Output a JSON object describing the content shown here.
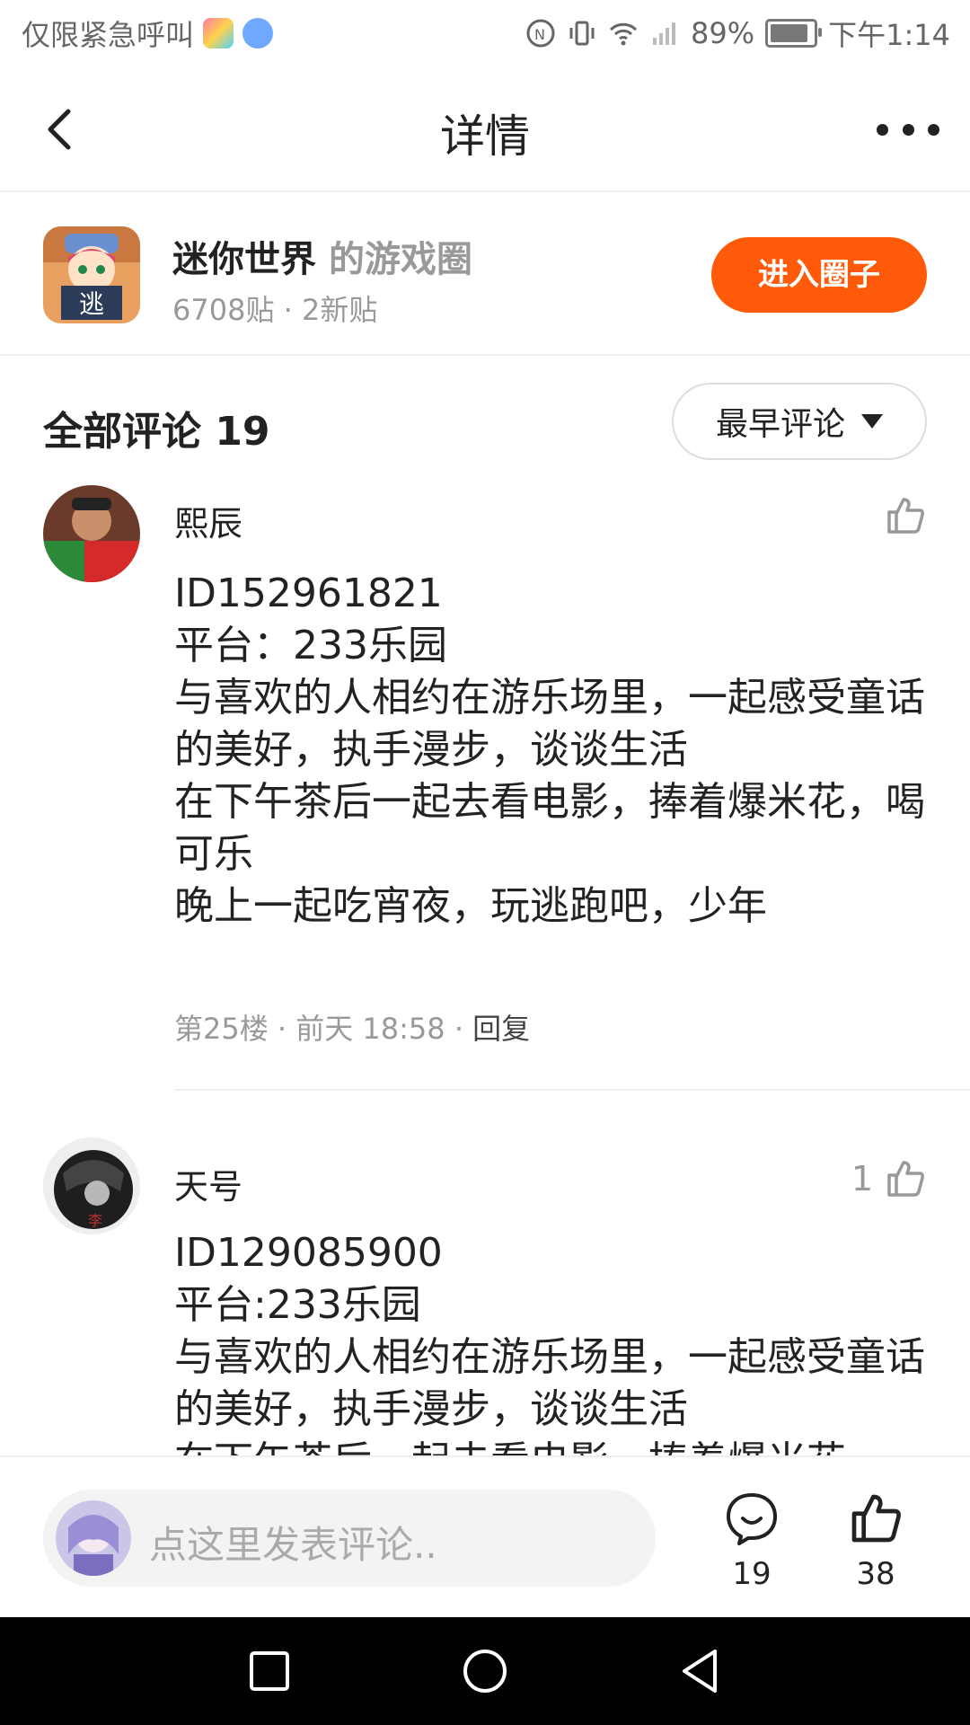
{
  "status_bar": {
    "carrier": "仅限紧急呼叫",
    "battery": "89%",
    "battery_level": 0.89,
    "time": "下午1:14",
    "icons": [
      "app-icon",
      "music-icon",
      "nfc-icon",
      "vibrate-icon",
      "wifi-icon",
      "signal-icon",
      "battery-icon"
    ]
  },
  "nav": {
    "title": "详情",
    "icons": [
      "back-chevron-icon",
      "more-dots-icon"
    ]
  },
  "circle": {
    "name": "迷你世界",
    "suffix": "的游戏圈",
    "stats": "6708贴 · 2新贴",
    "join_label": "进入圈子",
    "accent": "#ff5a0a"
  },
  "comments_header": {
    "title": "全部评论 19",
    "sort_label": "最早评论"
  },
  "comments": [
    {
      "user": "熙辰",
      "likes": "",
      "body": "ID152961821\n平台：233乐园\n与喜欢的人相约在游乐场里，一起感受童话的美好，执手漫步，谈谈生活\n在下午茶后一起去看电影，捧着爆米花，喝可乐\n晚上一起吃宵夜，玩逃跑吧，少年",
      "floor": "第25楼",
      "time": "前天 18:58",
      "reply": "回复"
    },
    {
      "user": "天号",
      "likes": "1",
      "body": "ID129085900\n平台:233乐园\n与喜欢的人相约在游乐场里，一起感受童话的美好，执手漫步，谈谈生活\n在下午茶后一起去看电影，捧着爆米花"
    }
  ],
  "bottom": {
    "placeholder": "点这里发表评论..",
    "comment_count": "19",
    "like_count": "38"
  }
}
